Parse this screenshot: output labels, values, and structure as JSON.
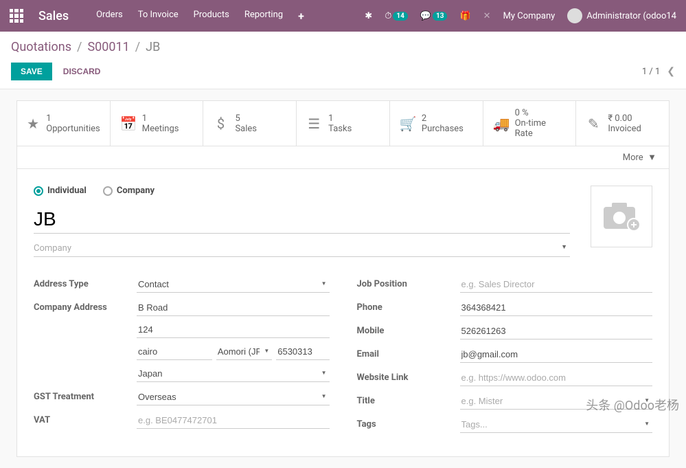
{
  "topbar": {
    "app": "Sales",
    "nav": {
      "orders": "Orders",
      "to_invoice": "To Invoice",
      "products": "Products",
      "reporting": "Reporting",
      "plus": "+"
    },
    "badges": {
      "activities": "14",
      "discuss": "13"
    },
    "company": "My Company",
    "user": "Administrator (odoo14"
  },
  "breadcrumb": {
    "root": "Quotations",
    "mid": "S00011",
    "current": "JB"
  },
  "actions": {
    "save": "SAVE",
    "discard": "DISCARD",
    "pager": "1 / 1"
  },
  "stats": {
    "opportunities": {
      "val": "1",
      "lbl": "Opportunities"
    },
    "meetings": {
      "val": "1",
      "lbl": "Meetings"
    },
    "sales": {
      "val": "5",
      "lbl": "Sales"
    },
    "tasks": {
      "val": "1",
      "lbl": "Tasks"
    },
    "purchases": {
      "val": "2",
      "lbl": "Purchases"
    },
    "ontime": {
      "val": "0  %",
      "lbl": "On-time Rate"
    },
    "invoiced": {
      "val": "₹ 0.00",
      "lbl": "Invoiced"
    },
    "more": "More"
  },
  "form": {
    "radio": {
      "individual": "Individual",
      "company": "Company"
    },
    "name": "JB",
    "company_placeholder": "Company",
    "left": {
      "address_type": {
        "label": "Address Type",
        "value": "Contact"
      },
      "company_address": {
        "label": "Company Address"
      },
      "street": "B Road",
      "street2": "124",
      "city": "cairo",
      "state": "Aomori (JP",
      "zip": "6530313",
      "country": "Japan",
      "gst": {
        "label": "GST Treatment",
        "value": "Overseas"
      },
      "vat": {
        "label": "VAT",
        "placeholder": "e.g. BE0477472701"
      }
    },
    "right": {
      "job": {
        "label": "Job Position",
        "placeholder": "e.g. Sales Director"
      },
      "phone": {
        "label": "Phone",
        "value": "364368421"
      },
      "mobile": {
        "label": "Mobile",
        "value": "526261263"
      },
      "email": {
        "label": "Email",
        "value": "jb@gmail.com"
      },
      "website": {
        "label": "Website Link",
        "placeholder": "e.g. https://www.odoo.com"
      },
      "title": {
        "label": "Title",
        "placeholder": "e.g. Mister"
      },
      "tags": {
        "label": "Tags",
        "placeholder": "Tags..."
      }
    }
  },
  "watermark": "头条 @Odoo老杨"
}
